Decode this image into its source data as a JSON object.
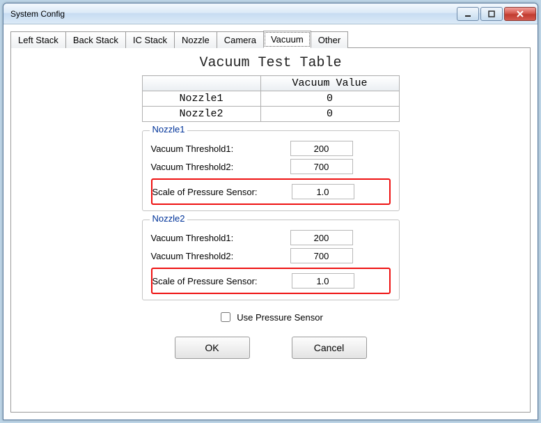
{
  "window_title": "System Config",
  "tabs": [
    "Left Stack",
    "Back Stack",
    "IC Stack",
    "Nozzle",
    "Camera",
    "Vacuum",
    "Other"
  ],
  "active_tab": "Vacuum",
  "heading": "Vacuum Test Table",
  "table": {
    "col_header": "Vacuum Value",
    "rows": [
      {
        "name": "Nozzle1",
        "value": "0"
      },
      {
        "name": "Nozzle2",
        "value": "0"
      }
    ]
  },
  "groups": {
    "n1": {
      "title": "Nozzle1",
      "thresh1_label": "Vacuum Threshold1:",
      "thresh1_value": "200",
      "thresh2_label": "Vacuum Threshold2:",
      "thresh2_value": "700",
      "scale_label": "Scale of Pressure Sensor:",
      "scale_value": "1.0"
    },
    "n2": {
      "title": "Nozzle2",
      "thresh1_label": "Vacuum Threshold1:",
      "thresh1_value": "200",
      "thresh2_label": "Vacuum Threshold2:",
      "thresh2_value": "700",
      "scale_label": "Scale of Pressure Sensor:",
      "scale_value": "1.0"
    }
  },
  "use_sensor_label": "Use Pressure Sensor",
  "ok_label": "OK",
  "cancel_label": "Cancel"
}
